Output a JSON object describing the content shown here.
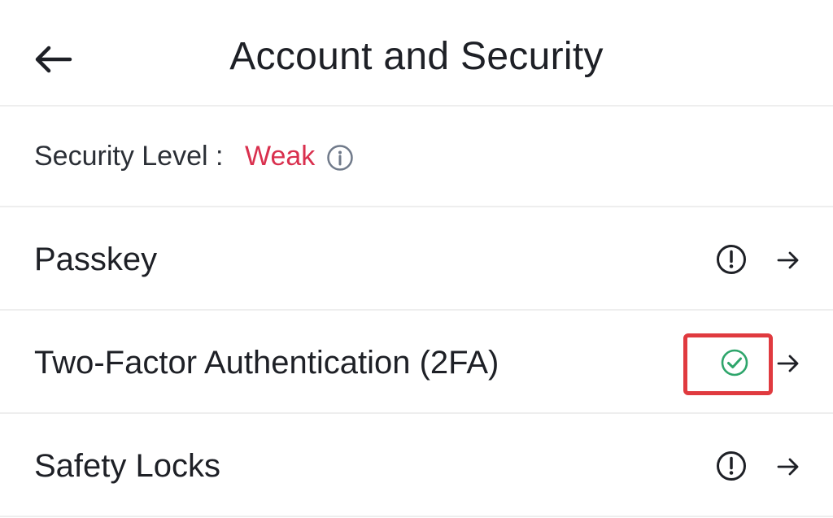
{
  "header": {
    "title": "Account and Security",
    "back_icon": "back-arrow-icon"
  },
  "security": {
    "label": "Security Level :",
    "value": "Weak",
    "value_color": "#d9304e",
    "info_icon": "info-icon"
  },
  "menu": {
    "items": [
      {
        "label": "Passkey",
        "status": "warning",
        "status_icon": "exclamation-circle-icon",
        "arrow_icon": "arrow-right-icon"
      },
      {
        "label": "Two-Factor Authentication (2FA)",
        "status": "enabled",
        "status_icon": "check-circle-icon",
        "status_color": "#2ea56b",
        "arrow_icon": "arrow-right-icon",
        "highlighted": true
      },
      {
        "label": "Safety Locks",
        "status": "warning",
        "status_icon": "exclamation-circle-icon",
        "arrow_icon": "arrow-right-icon"
      }
    ]
  },
  "colors": {
    "highlight": "#e03a3f",
    "divider": "#eeeeee",
    "text": "#1e2026"
  }
}
